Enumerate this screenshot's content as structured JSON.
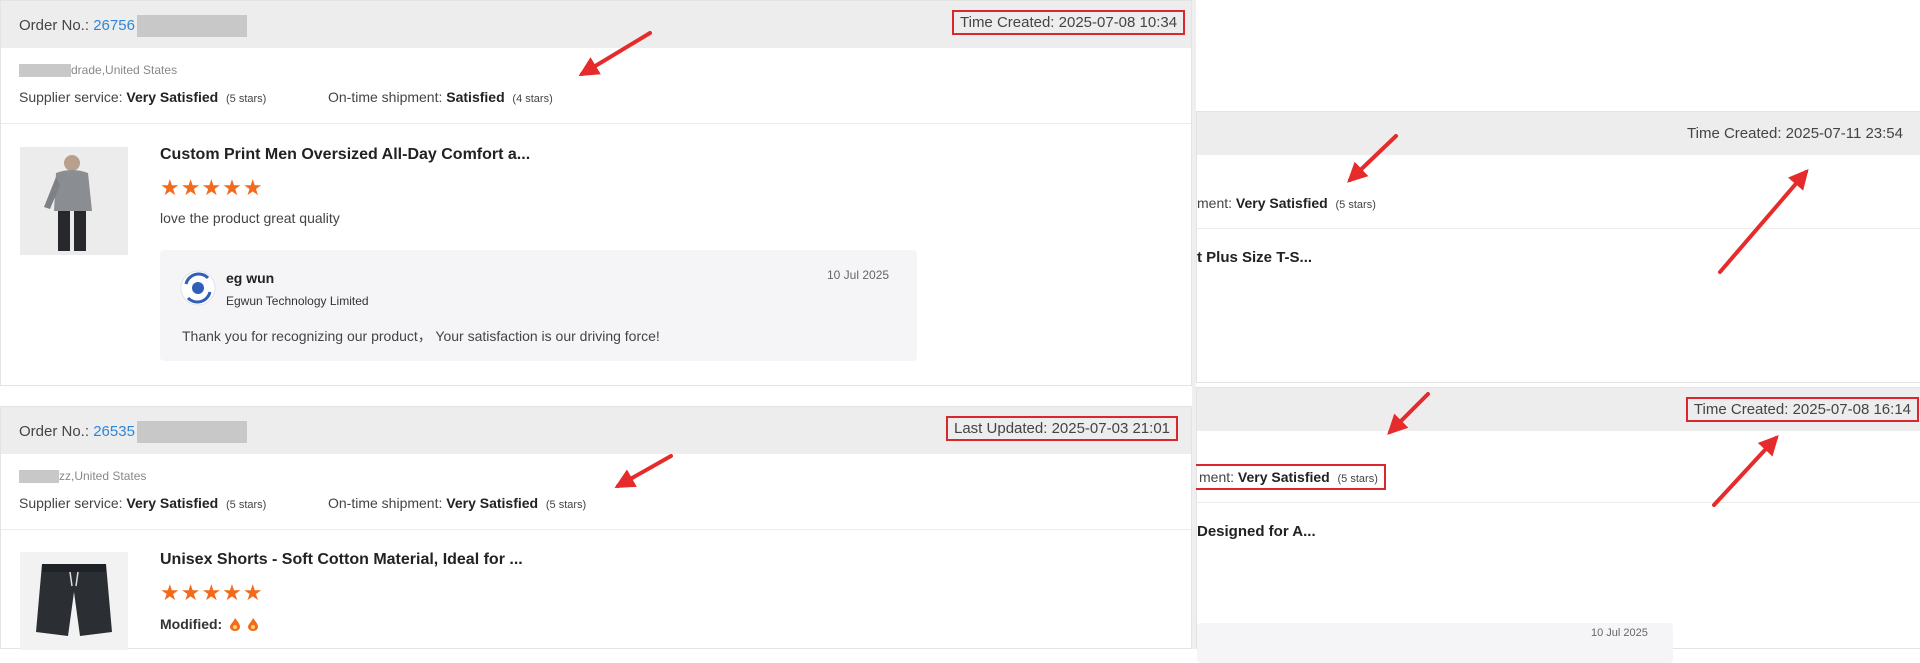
{
  "cards": {
    "order1": {
      "order_label": "Order No.:",
      "order_no": "26756",
      "time_label": "Time Created: 2025-07-08 10:34",
      "location": "drade,United States",
      "supplier_label": "Supplier service:",
      "supplier_value": "Very Satisfied",
      "supplier_stars": "(5 stars)",
      "shipment_label": "On-time shipment:",
      "shipment_value": "Satisfied",
      "shipment_stars": "(4 stars)",
      "product_title": "Custom Print Men Oversized All-Day Comfort a...",
      "rating": 5,
      "review_text": "love the product great quality",
      "reply": {
        "name": "eg wun",
        "company": "Egwun Technology Limited",
        "date": "10 Jul 2025",
        "text": "Thank you for recognizing our product， Your satisfaction is our driving force!"
      }
    },
    "order2": {
      "order_label": "Order No.:",
      "order_no": "26535",
      "time_label": "Last Updated: 2025-07-03 21:01",
      "location": "zz,United States",
      "supplier_label": "Supplier service:",
      "supplier_value": "Very Satisfied",
      "supplier_stars": "(5 stars)",
      "shipment_label": "On-time shipment:",
      "shipment_value": "Very Satisfied",
      "shipment_stars": "(5 stars)",
      "product_title": "Unisex Shorts - Soft Cotton Material, Ideal for ...",
      "rating": 5,
      "modified_label": "Modified:"
    },
    "right1": {
      "time_label": "Time Created: 2025-07-11 23:54",
      "shipment_label": "ment:",
      "shipment_value": "Very Satisfied",
      "shipment_stars": "(5 stars)",
      "product_title": "t Plus Size T-S..."
    },
    "right2": {
      "time_label": "Time Created: 2025-07-08 16:14",
      "shipment_label": "ment:",
      "shipment_value": "Very Satisfied",
      "shipment_stars": "(5 stars)",
      "product_title": "Designed for A...",
      "reply_date": "10 Jul 2025"
    }
  },
  "colors": {
    "accent_red": "#d9272e",
    "star_orange": "#f26b1d",
    "link_blue": "#2f86d6"
  },
  "icons": {
    "star": "star-icon",
    "flame": "flame-icon",
    "avatar": "supplier-logo-icon"
  }
}
